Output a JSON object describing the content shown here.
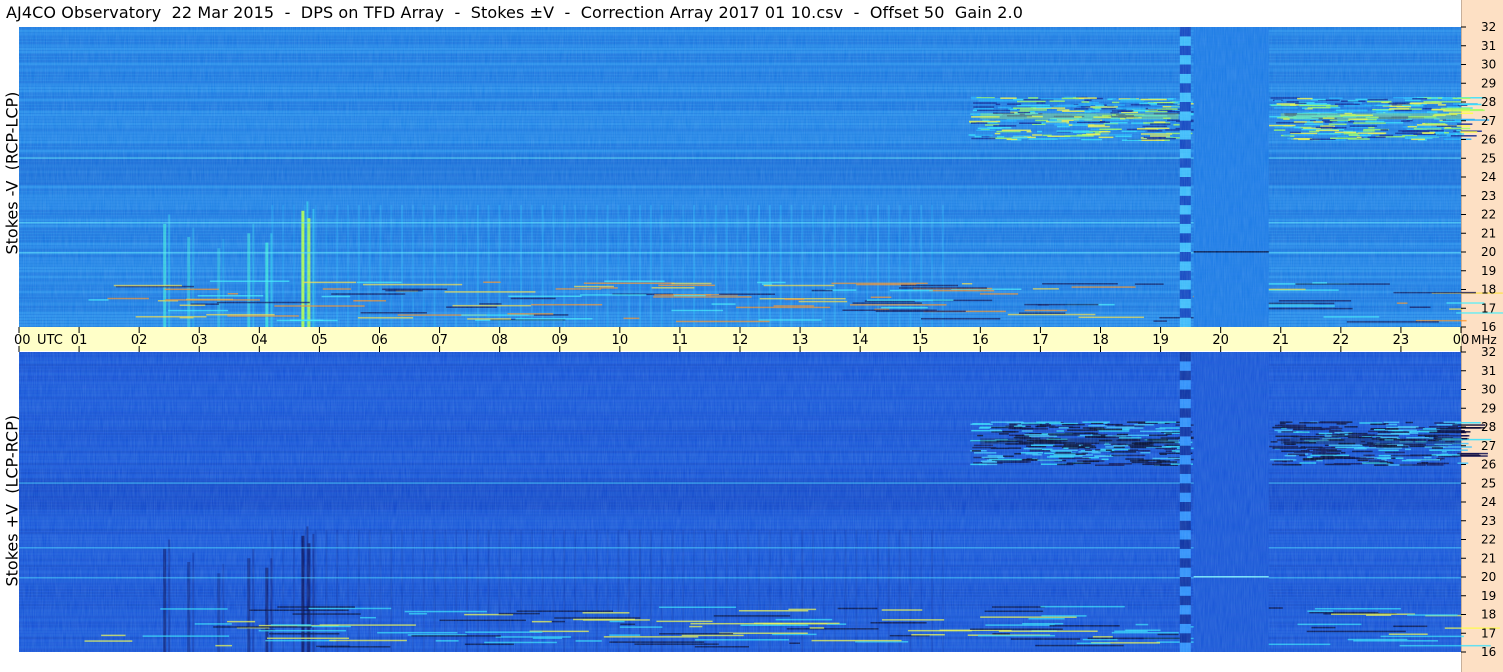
{
  "title": "AJ4CO Observatory  22 Mar 2015  -  DPS on TFD Array  -  Stokes ±V  -  Correction Array 2017 01 10.csv  -  Offset 50  Gain 2.0",
  "chart_data": {
    "type": "heatmap",
    "x_unit": "UTC",
    "x_ticks": [
      "00",
      "01",
      "02",
      "03",
      "04",
      "05",
      "06",
      "07",
      "08",
      "09",
      "10",
      "11",
      "12",
      "13",
      "14",
      "15",
      "16",
      "17",
      "18",
      "19",
      "20",
      "21",
      "22",
      "23",
      "00"
    ],
    "x_range": [
      0,
      24
    ],
    "y_unit": "MHz",
    "y_ticks": [
      "32",
      "31",
      "30",
      "29",
      "28",
      "27",
      "26",
      "25",
      "24",
      "23",
      "22",
      "21",
      "20",
      "19",
      "18",
      "17",
      "16"
    ],
    "y_range": [
      16,
      32
    ],
    "colormap": [
      "#0a0a5a",
      "#0026c8",
      "#0060ff",
      "#1aa0ff",
      "#30e0ff",
      "#a0ff60",
      "#ffff00",
      "#ff8000"
    ],
    "panels": [
      {
        "ylabel": "Stokes -V  (RCP-LCP)",
        "base_color": "#1e7fe6"
      },
      {
        "ylabel": "Stokes +V  (LCP-RCP)",
        "base_color": "#1650da"
      }
    ]
  }
}
